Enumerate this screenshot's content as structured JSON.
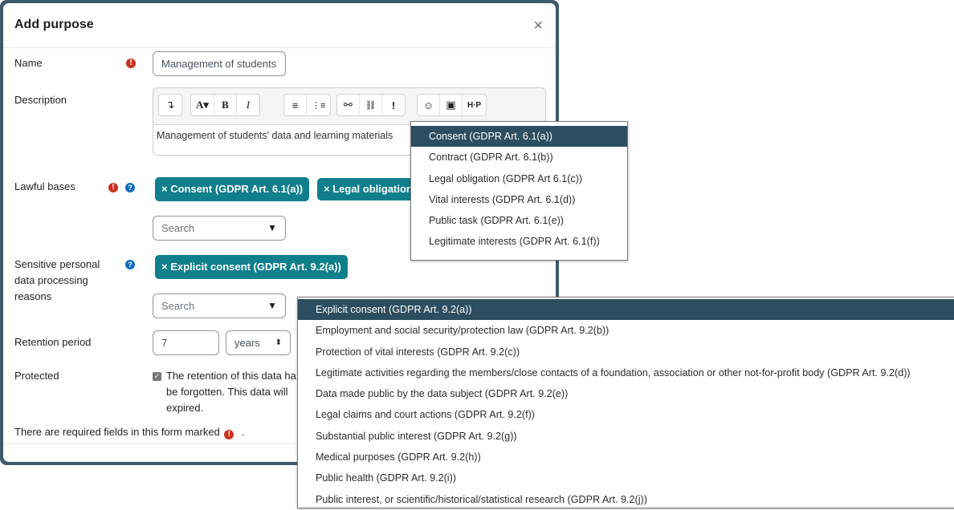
{
  "modal": {
    "title": "Add purpose",
    "close_label": "×"
  },
  "colors": {
    "tag": "#0f7f8c",
    "highlight": "#2c4e60",
    "required": "#ca3120",
    "help": "#0f6cbf",
    "frame": "#3e5b6b"
  },
  "form": {
    "name": {
      "label": "Name",
      "value": "Management of students"
    },
    "description": {
      "label": "Description",
      "toolbar": [
        "collapse",
        "font-style",
        "bold",
        "italic",
        "unordered-list",
        "ordered-list",
        "link",
        "unlink",
        "attention",
        "emoji",
        "image",
        "h5p"
      ],
      "toolbar_glyphs": {
        "collapse": "↴",
        "font": "A▾",
        "bold": "B",
        "italic": "I",
        "ul": "≡",
        "ol": "⋮≡",
        "link": "⚯",
        "unlink": "⛓",
        "attention": "!",
        "emoji": "☺",
        "image": "▣",
        "h5p": "H·P"
      },
      "value": "Management of students' data and learning materials"
    },
    "lawful_bases": {
      "label": "Lawful bases",
      "tags": [
        "× Consent (GDPR Art. 6.1(a))",
        "× Legal obligation"
      ],
      "search_placeholder": "Search",
      "options": [
        "Consent (GDPR Art. 6.1(a))",
        "Contract (GDPR Art. 6.1(b))",
        "Legal obligation (GDPR Art 6.1(c))",
        "Vital interests (GDPR Art. 6.1(d))",
        "Public task (GDPR Art. 6.1(e))",
        "Legitimate interests (GDPR Art. 6.1(f))"
      ],
      "selected_option": "Consent (GDPR Art. 6.1(a))"
    },
    "sensitive": {
      "label_lines": [
        "Sensitive personal",
        "data processing",
        "reasons"
      ],
      "tags": [
        "× Explicit consent (GDPR Art. 9.2(a))"
      ],
      "search_placeholder": "Search",
      "options": [
        "Explicit consent (GDPR Art. 9.2(a))",
        "Employment and social security/protection law (GDPR Art. 9.2(b))",
        "Protection of vital interests (GDPR Art. 9.2(c))",
        "Legitimate activities regarding the members/close contacts of a foundation, association or other not-for-profit body (GDPR Art. 9.2(d))",
        "Data made public by the data subject (GDPR Art. 9.2(e))",
        "Legal claims and court actions (GDPR Art. 9.2(f))",
        "Substantial public interest (GDPR Art. 9.2(g))",
        "Medical purposes (GDPR Art. 9.2(h))",
        "Public health (GDPR Art. 9.2(i))",
        "Public interest, or scientific/historical/statistical research (GDPR Art. 9.2(j))"
      ],
      "selected_option": "Explicit consent (GDPR Art. 9.2(a))"
    },
    "retention": {
      "label": "Retention period",
      "value": "7",
      "unit": "years"
    },
    "protected": {
      "label": "Protected",
      "checked": true,
      "text_lines": [
        "The retention of this data ha",
        "be forgotten. This data will",
        "expired."
      ]
    },
    "required_note": "There are required fields in this form marked",
    "required_note_end": "."
  }
}
